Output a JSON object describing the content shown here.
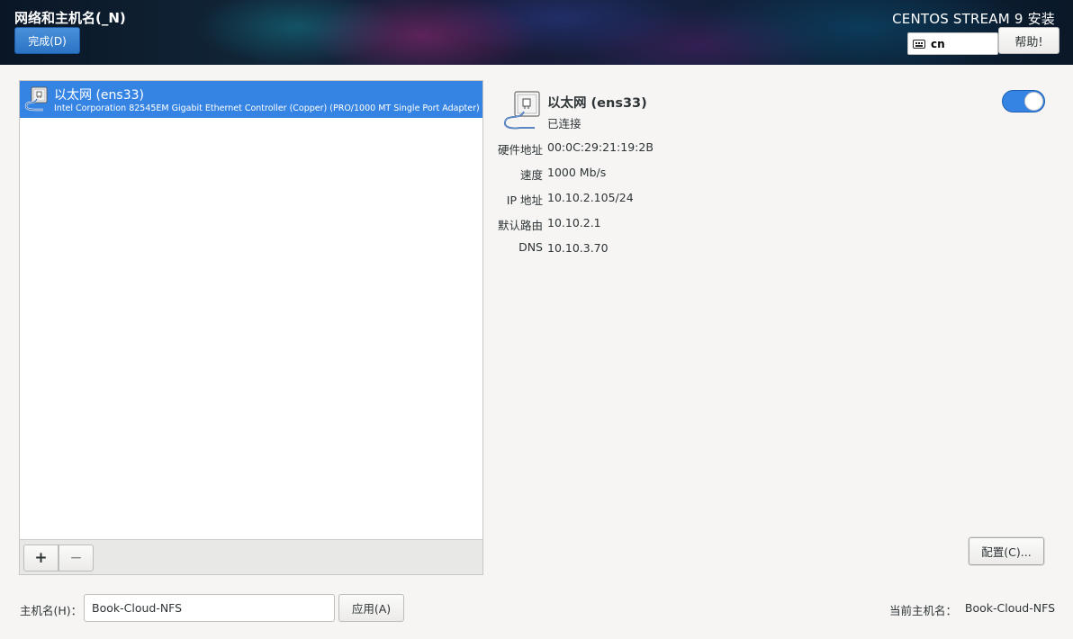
{
  "header": {
    "title": "网络和主机名(_N)",
    "done_label": "完成(D)",
    "product": "CENTOS STREAM 9 安装",
    "keyboard_layout": "cn",
    "help_label": "帮助!"
  },
  "device_list": {
    "items": [
      {
        "name": "以太网 (ens33)",
        "description": "Intel Corporation 82545EM Gigabit Ethernet Controller (Copper) (PRO/1000 MT Single Port Adapter)",
        "selected": true,
        "icon": "network-wired-icon"
      }
    ],
    "add_label": "+",
    "remove_label": "−"
  },
  "details": {
    "name": "以太网 (ens33)",
    "status": "已连接",
    "enabled": true,
    "properties": [
      {
        "label": "硬件地址",
        "value": "00:0C:29:21:19:2B"
      },
      {
        "label": "速度",
        "value": "1000 Mb/s"
      },
      {
        "label": "IP 地址",
        "value": "10.10.2.105/24"
      },
      {
        "label": "默认路由",
        "value": "10.10.2.1"
      },
      {
        "label": "DNS",
        "value": "10.10.3.70"
      }
    ],
    "configure_label": "配置(C)..."
  },
  "hostname": {
    "label": "主机名(H)：",
    "value": "Book-Cloud-NFS",
    "apply_label": "应用(A)",
    "current_label": "当前主机名：",
    "current_value": "Book-Cloud-NFS"
  },
  "colors": {
    "accent": "#3584e4",
    "background": "#f6f5f4"
  }
}
